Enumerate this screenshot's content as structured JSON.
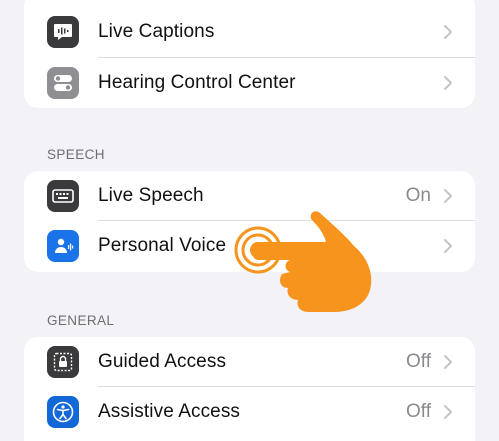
{
  "groups": {
    "hearing": {
      "items": [
        {
          "label": "Live Captions",
          "icon": "waveform-bubble-icon"
        },
        {
          "label": "Hearing Control Center",
          "icon": "toggles-icon"
        }
      ]
    },
    "speech": {
      "header": "SPEECH",
      "items": [
        {
          "label": "Live Speech",
          "value": "On",
          "icon": "keyboard-icon"
        },
        {
          "label": "Personal Voice",
          "icon": "person-voice-icon"
        }
      ]
    },
    "general": {
      "header": "GENERAL",
      "items": [
        {
          "label": "Guided Access",
          "value": "Off",
          "icon": "lock-frame-icon"
        },
        {
          "label": "Assistive Access",
          "value": "Off",
          "icon": "accessibility-icon"
        }
      ]
    }
  },
  "overlay": {
    "icon": "tap-hand-icon"
  },
  "colors": {
    "background": "#f2f2f7",
    "accent_orange": "#f7941d",
    "chevron": "#c4c4c7"
  }
}
